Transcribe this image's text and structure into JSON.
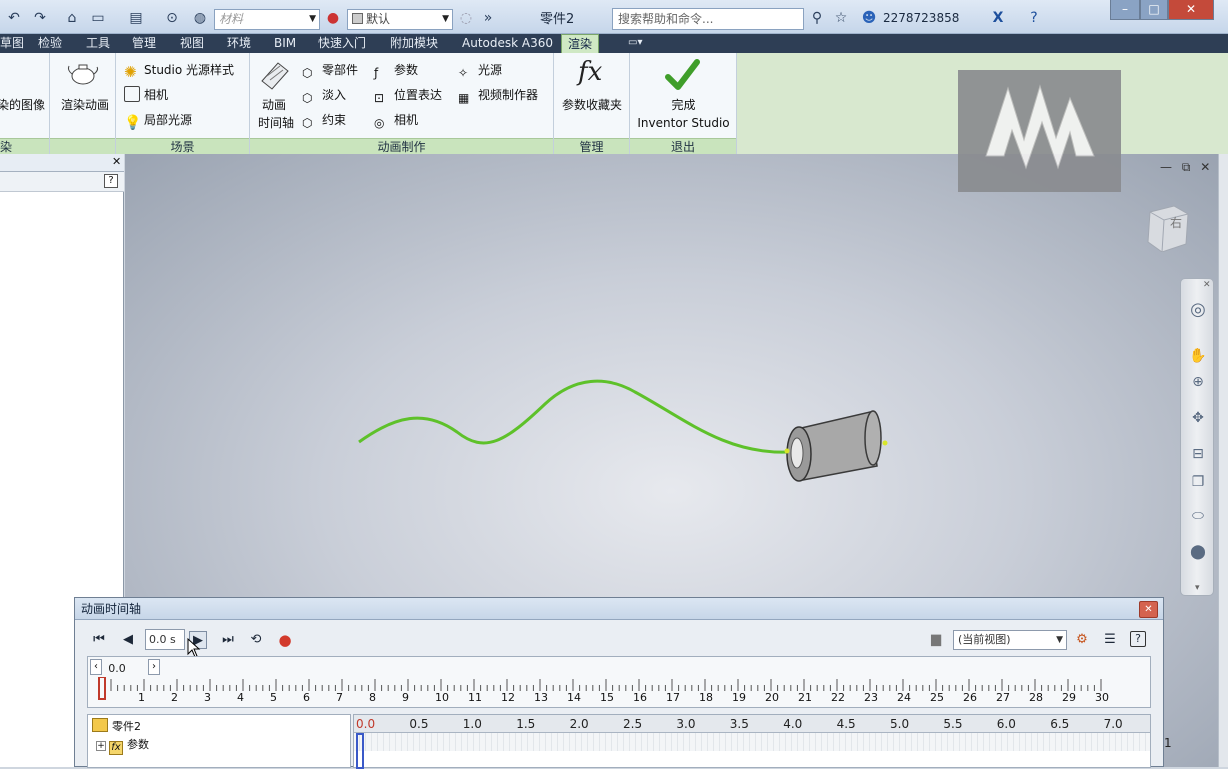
{
  "titlebar": {
    "material_placeholder": "材料",
    "appearance_value": "默认",
    "document_title": "零件2",
    "help_search_placeholder": "搜索帮助和命令...",
    "user": "2278723858"
  },
  "menu_tabs": [
    {
      "label": "草图"
    },
    {
      "label": "检验"
    },
    {
      "label": "工具"
    },
    {
      "label": "管理"
    },
    {
      "label": "视图"
    },
    {
      "label": "环境"
    },
    {
      "label": "BIM"
    },
    {
      "label": "快速入门"
    },
    {
      "label": "附加模块"
    },
    {
      "label": "Autodesk A360"
    },
    {
      "label": "渲染"
    }
  ],
  "ribbon": {
    "render_group": {
      "image_label": "染的图像",
      "anim_label": "渲染动画",
      "group": "染"
    },
    "scene_group": {
      "items": [
        "Studio 光源样式",
        "相机",
        "局部光源"
      ],
      "label": "场景"
    },
    "animation_group": {
      "timeline_label_1": "动画",
      "timeline_label_2": "时间轴",
      "col1": [
        "零部件",
        "淡入",
        "约束"
      ],
      "col2": [
        "参数",
        "位置表达",
        "相机"
      ],
      "col3": [
        "光源",
        "视频制作器"
      ],
      "label": "动画制作"
    },
    "manage_group": {
      "fav_label": "参数收藏夹",
      "label": "管理"
    },
    "exit_group": {
      "finish_1": "完成",
      "finish_2": "Inventor Studio",
      "label": "退出"
    }
  },
  "viewcube": {
    "face": "右"
  },
  "timeline": {
    "title": "动画时间轴",
    "time_value": "0.0 s",
    "view_option": "(当前视图)",
    "zoom_value": "0.0",
    "ruler_labels": [
      "1",
      "2",
      "3",
      "4",
      "5",
      "6",
      "7",
      "8",
      "9",
      "10",
      "11",
      "12",
      "13",
      "14",
      "15",
      "16",
      "17",
      "18",
      "19",
      "20",
      "21",
      "22",
      "23",
      "24",
      "25",
      "26",
      "27",
      "28",
      "29",
      "30"
    ],
    "tree": {
      "root": "零件2",
      "child": "参数"
    },
    "track_scale": [
      "0.0",
      "0.5",
      "1.0",
      "1.5",
      "2.0",
      "2.5",
      "3.0",
      "3.5",
      "4.0",
      "4.5",
      "5.0",
      "5.5",
      "6.0",
      "6.5",
      "7.0"
    ]
  },
  "status_right": "1"
}
